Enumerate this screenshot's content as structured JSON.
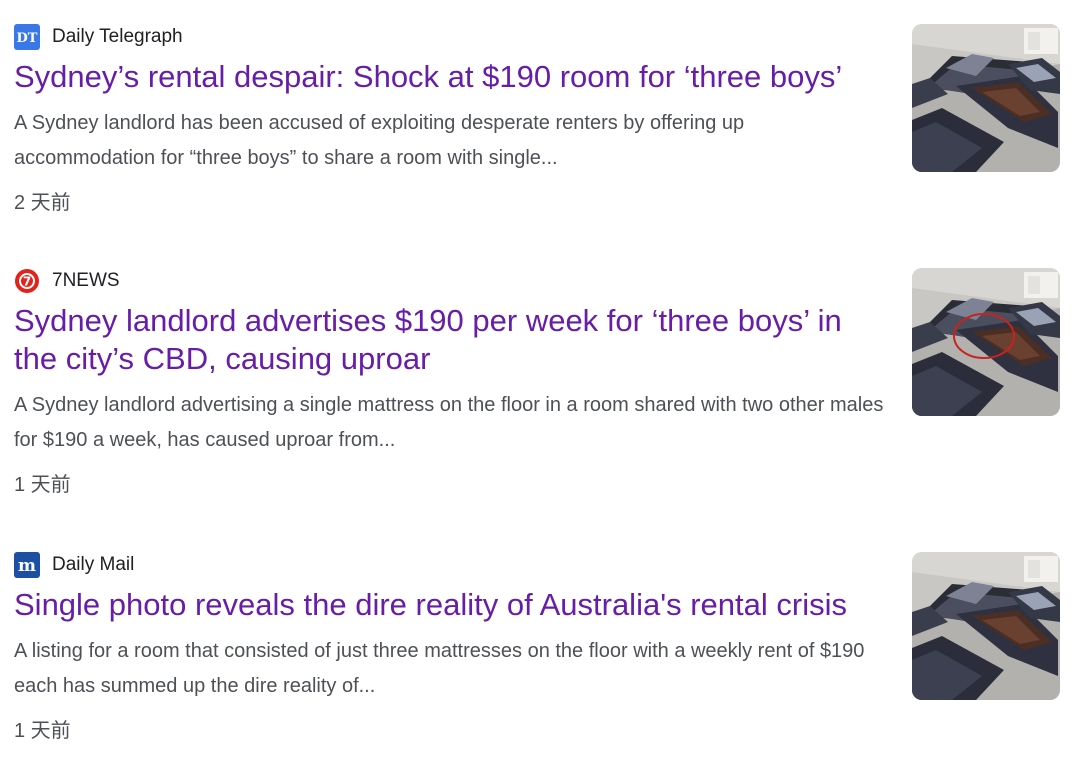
{
  "articles": [
    {
      "source": "Daily Telegraph",
      "logo_text": "DT",
      "logo_icon": "daily-telegraph-logo-icon",
      "logo_color": "#3b78e7",
      "headline": "Sydney’s rental despair: Shock at $190 room for ‘three boys’",
      "snippet": "A Sydney landlord has been accused of exploiting desperate renters by offering up accommodation for “three boys” to share a room with single...",
      "age": "2 天前",
      "thumbnail": "mattresses-on-floor-photo"
    },
    {
      "source": "7NEWS",
      "logo_text": "7",
      "logo_icon": "7news-logo-icon",
      "logo_color": "#e2231a",
      "headline": "Sydney landlord advertises $190 per week for ‘three boys’ in the city’s CBD, causing uproar",
      "snippet": "A Sydney landlord advertising a single mattress on the floor in a room shared with two other males for $190 a week, has caused uproar from...",
      "age": "1 天前",
      "thumbnail": "mattresses-on-floor-circled-photo"
    },
    {
      "source": "Daily Mail",
      "logo_text": "m",
      "logo_icon": "daily-mail-logo-icon",
      "logo_color": "#1d4fa3",
      "headline": "Single photo reveals the dire reality of Australia's rental crisis",
      "snippet": "A listing for a room that consisted of just three mattresses on the floor with a weekly rent of $190 each has summed up the dire reality of...",
      "age": "1 天前",
      "thumbnail": "mattresses-on-floor-photo"
    }
  ],
  "colors": {
    "headline_visited": "#681da8",
    "snippet_text": "#4d5156",
    "source_text": "#202124"
  }
}
